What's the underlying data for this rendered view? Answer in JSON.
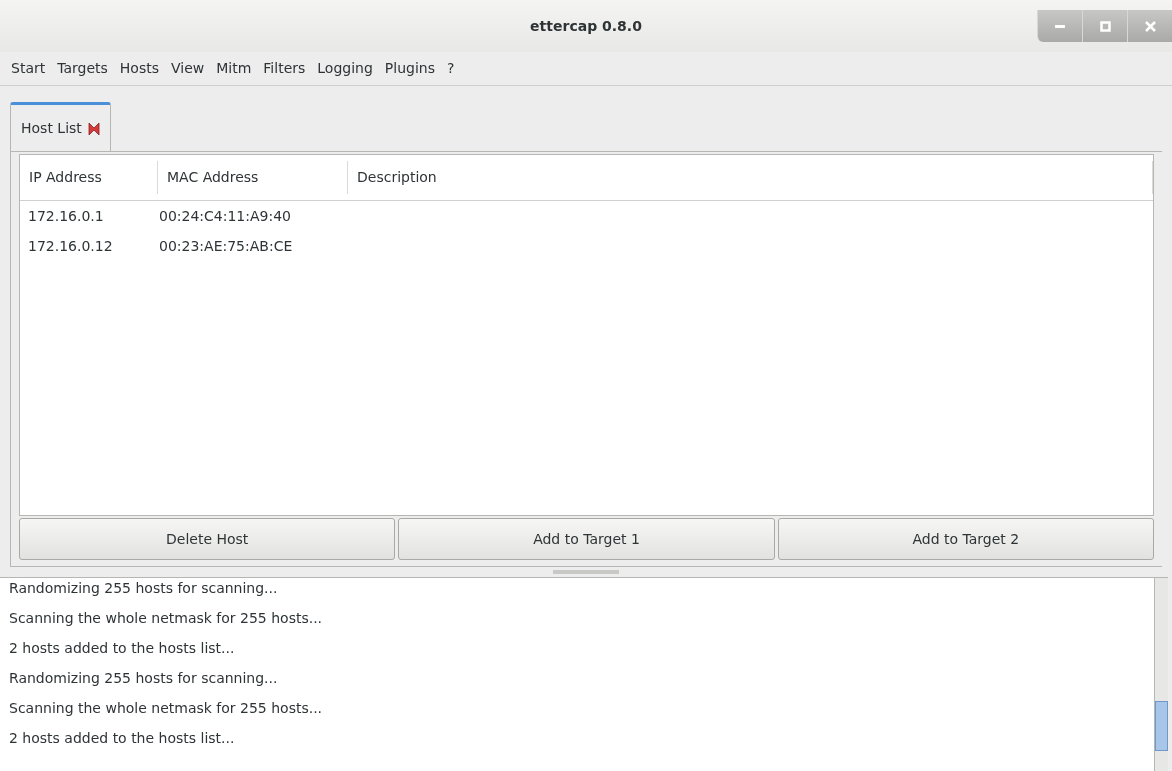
{
  "window": {
    "title": "ettercap 0.8.0"
  },
  "menu": [
    "Start",
    "Targets",
    "Hosts",
    "View",
    "Mitm",
    "Filters",
    "Logging",
    "Plugins",
    "?"
  ],
  "tabs": [
    {
      "label": "Host List",
      "selected": true
    }
  ],
  "table": {
    "columns": [
      "IP Address",
      "MAC Address",
      "Description"
    ],
    "rows": [
      [
        "172.16.0.1",
        "00:24:C4:11:A9:40",
        ""
      ],
      [
        "172.16.0.12",
        "00:23:AE:75:AB:CE",
        ""
      ]
    ]
  },
  "buttons": [
    "Delete Host",
    "Add to Target 1",
    "Add to Target 2"
  ],
  "log": [
    "Randomizing 255 hosts for scanning...",
    "Scanning the whole netmask for 255 hosts...",
    "2 hosts added to the hosts list...",
    "Randomizing 255 hosts for scanning...",
    "Scanning the whole netmask for 255 hosts...",
    "2 hosts added to the hosts list..."
  ]
}
